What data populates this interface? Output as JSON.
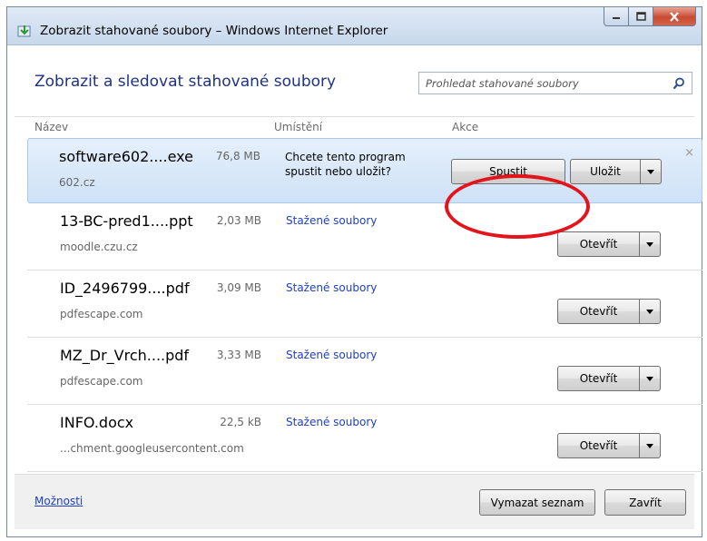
{
  "window": {
    "title": "Zobrazit stahované soubory – Windows Internet Explorer"
  },
  "header": {
    "heading": "Zobrazit a sledovat stahované soubory",
    "search_placeholder": "Prohledat stahované soubory"
  },
  "columns": {
    "name": "Název",
    "location": "Umístění",
    "actions": "Akce"
  },
  "downloads": [
    {
      "name": "software602....exe",
      "size": "76,8 MB",
      "source": "602.cz",
      "prompt": "Chcete tento program spustit nebo uložit?",
      "run_label": "Spustit",
      "save_label": "Uložit",
      "dismiss": "×"
    },
    {
      "name": "13-BC-pred1....ppt",
      "size": "2,03 MB",
      "source": "moodle.czu.cz",
      "location": "Stažené soubory",
      "open_label": "Otevřít"
    },
    {
      "name": "ID_2496799....pdf",
      "size": "3,09 MB",
      "source": "pdfescape.com",
      "location": "Stažené soubory",
      "open_label": "Otevřít"
    },
    {
      "name": "MZ_Dr_Vrch....pdf",
      "size": "3,33 MB",
      "source": "pdfescape.com",
      "location": "Stažené soubory",
      "open_label": "Otevřít"
    },
    {
      "name": "INFO.docx",
      "size": "22,5 kB",
      "source": "...chment.googleusercontent.com",
      "location": "Stažené soubory",
      "open_label": "Otevřít"
    }
  ],
  "footer": {
    "options_label": "Možnosti",
    "clear_list_label": "Vymazat seznam",
    "close_label": "Zavřít"
  },
  "colors": {
    "heading": "#1e3287",
    "link": "#1e3fbf",
    "callout": "#e3151c",
    "selected_row": "#d7e7f9"
  }
}
